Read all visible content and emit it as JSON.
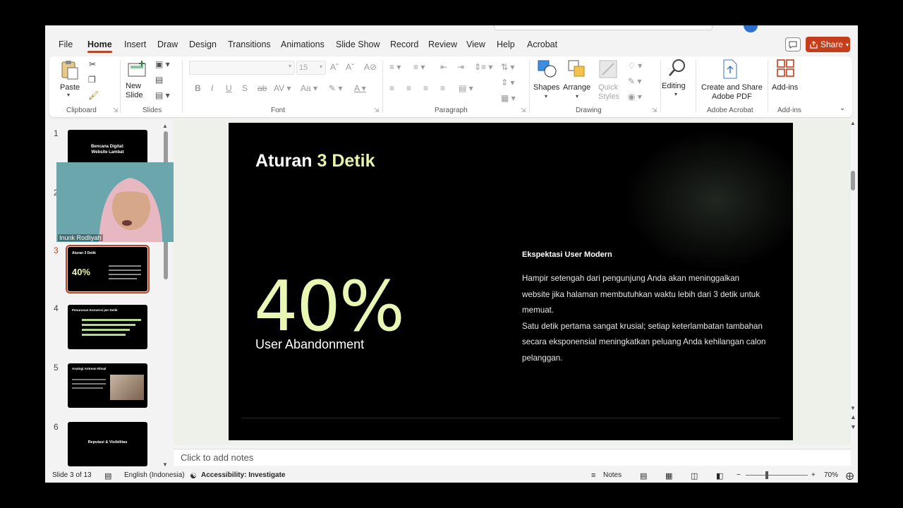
{
  "menu": {
    "tabs": [
      "File",
      "Home",
      "Insert",
      "Draw",
      "Design",
      "Transitions",
      "Animations",
      "Slide Show",
      "Record",
      "Review",
      "View",
      "Help",
      "Acrobat"
    ],
    "active_tab": "Home",
    "share_label": "Share"
  },
  "ribbon": {
    "clipboard": {
      "paste_label": "Paste",
      "group_label": "Clipboard"
    },
    "slides": {
      "new_slide_label": "New\nSlide",
      "group_label": "Slides"
    },
    "font": {
      "font_size": "15",
      "group_label": "Font"
    },
    "paragraph": {
      "group_label": "Paragraph"
    },
    "drawing": {
      "shapes_label": "Shapes",
      "arrange_label": "Arrange",
      "quick_styles_label": "Quick\nStyles",
      "group_label": "Drawing"
    },
    "editing": {
      "label": "Editing"
    },
    "adobe": {
      "label": "Create and Share\nAdobe PDF",
      "group_label": "Adobe Acrobat"
    },
    "addins": {
      "label": "Add-ins",
      "group_label": "Add-ins"
    }
  },
  "thumbnails": [
    {
      "num": "1",
      "title": "Bencana Digital:\nWebsite Lambat"
    },
    {
      "num": "2",
      "title": ""
    },
    {
      "num": "3",
      "title": "Aturan 3 Detik",
      "stat": "40%",
      "selected": true
    },
    {
      "num": "4",
      "title": "Penurunan Konversi per Detik"
    },
    {
      "num": "5",
      "title": "Analogi Antrean Ritual"
    },
    {
      "num": "6",
      "title": "Reputasi & Visibilitas"
    }
  ],
  "webcam": {
    "name": "Inunk Rodliyah"
  },
  "slide": {
    "title_part1": "Aturan ",
    "title_part2": "3 Detik",
    "stat": "40%",
    "stat_label": "User Abandonment",
    "exp_title": "Ekspektasi User Modern",
    "exp_body_1": "Hampir setengah dari pengunjung Anda akan meninggalkan website jika halaman membutuhkan waktu lebih dari 3 detik untuk memuat.",
    "exp_body_2": "Satu detik pertama sangat krusial; setiap keterlambatan tambahan secara eksponensial meningkatkan peluang Anda kehilangan calon pelanggan."
  },
  "notes": {
    "placeholder": "Click to add notes"
  },
  "status": {
    "slide_count": "Slide 3 of 13",
    "language": "English (Indonesia)",
    "accessibility": "Accessibility: Investigate",
    "notes_label": "Notes",
    "zoom": "70%"
  },
  "colors": {
    "accent": "#c43e1c",
    "slide_accent": "#e6f5a8"
  }
}
